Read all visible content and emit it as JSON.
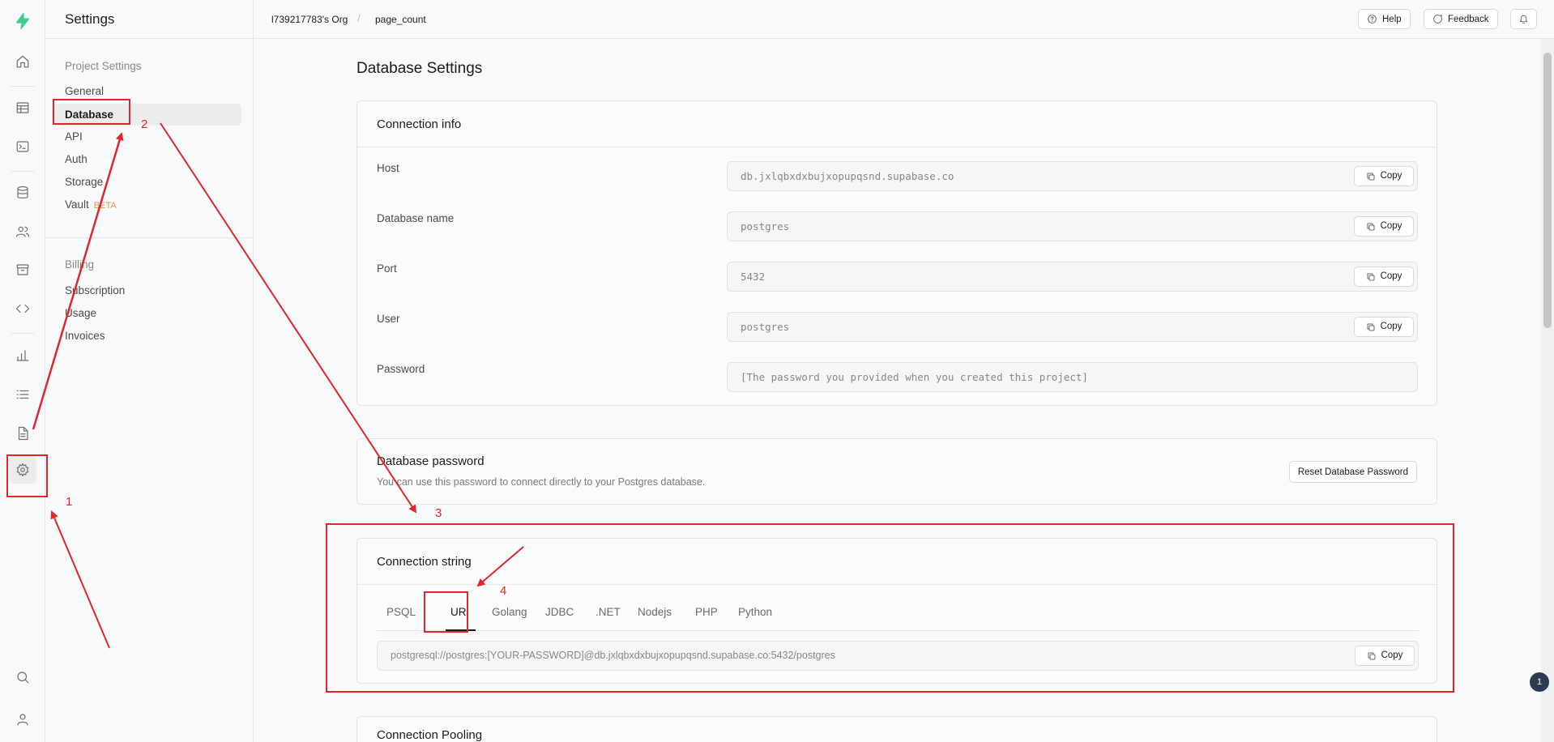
{
  "sidebar": {
    "title": "Settings",
    "project_group": "Project Settings",
    "items": [
      {
        "label": "General"
      },
      {
        "label": "Database"
      },
      {
        "label": "API"
      },
      {
        "label": "Auth"
      },
      {
        "label": "Storage"
      },
      {
        "label": "Vault",
        "badge": "BETA"
      }
    ],
    "billing_group": "Billing",
    "billing_items": [
      {
        "label": "Subscription"
      },
      {
        "label": "Usage"
      },
      {
        "label": "Invoices"
      }
    ]
  },
  "rail_icons": [
    "bolt-logo-icon",
    "home-icon",
    "table-editor-icon",
    "sql-editor-icon",
    "database-icon",
    "users-icon",
    "storage-icon",
    "code-icon",
    "reports-icon",
    "logs-icon",
    "docs-icon",
    "settings-icon",
    "search-icon",
    "user-icon"
  ],
  "breadcrumb": {
    "org": "l739217783's Org",
    "separator": "/",
    "project": "page_count"
  },
  "topbar": {
    "help": "Help",
    "feedback": "Feedback"
  },
  "page_title": "Database Settings",
  "connection_info": {
    "title": "Connection info",
    "rows": [
      {
        "label": "Host",
        "value": "db.jxlqbxdxbujxopupqsnd.supabase.co",
        "copy": "Copy"
      },
      {
        "label": "Database name",
        "value": "postgres",
        "copy": "Copy"
      },
      {
        "label": "Port",
        "value": "5432",
        "copy": "Copy"
      },
      {
        "label": "User",
        "value": "postgres",
        "copy": "Copy"
      },
      {
        "label": "Password",
        "value": "[The password you provided when you created this project]"
      }
    ]
  },
  "db_password": {
    "title": "Database password",
    "description": "You can use this password to connect directly to your Postgres database.",
    "reset_label": "Reset Database Password"
  },
  "connection_string": {
    "title": "Connection string",
    "tabs": [
      "PSQL",
      "URI",
      "Golang",
      "JDBC",
      ".NET",
      "Nodejs",
      "PHP",
      "Python"
    ],
    "active_tab": "URI",
    "value": "postgresql://postgres:[YOUR-PASSWORD]@db.jxlqbxdxbujxopupqsnd.supabase.co:5432/postgres",
    "copy": "Copy"
  },
  "connection_pooling": {
    "title": "Connection Pooling"
  },
  "notification_count": "1",
  "annotations": {
    "steps": [
      "1",
      "2",
      "3",
      "4"
    ],
    "color": "#e0262c"
  },
  "colors": {
    "accent": "#3ecf8e",
    "annotation": "#e0262c",
    "beta": "#f1934a"
  }
}
